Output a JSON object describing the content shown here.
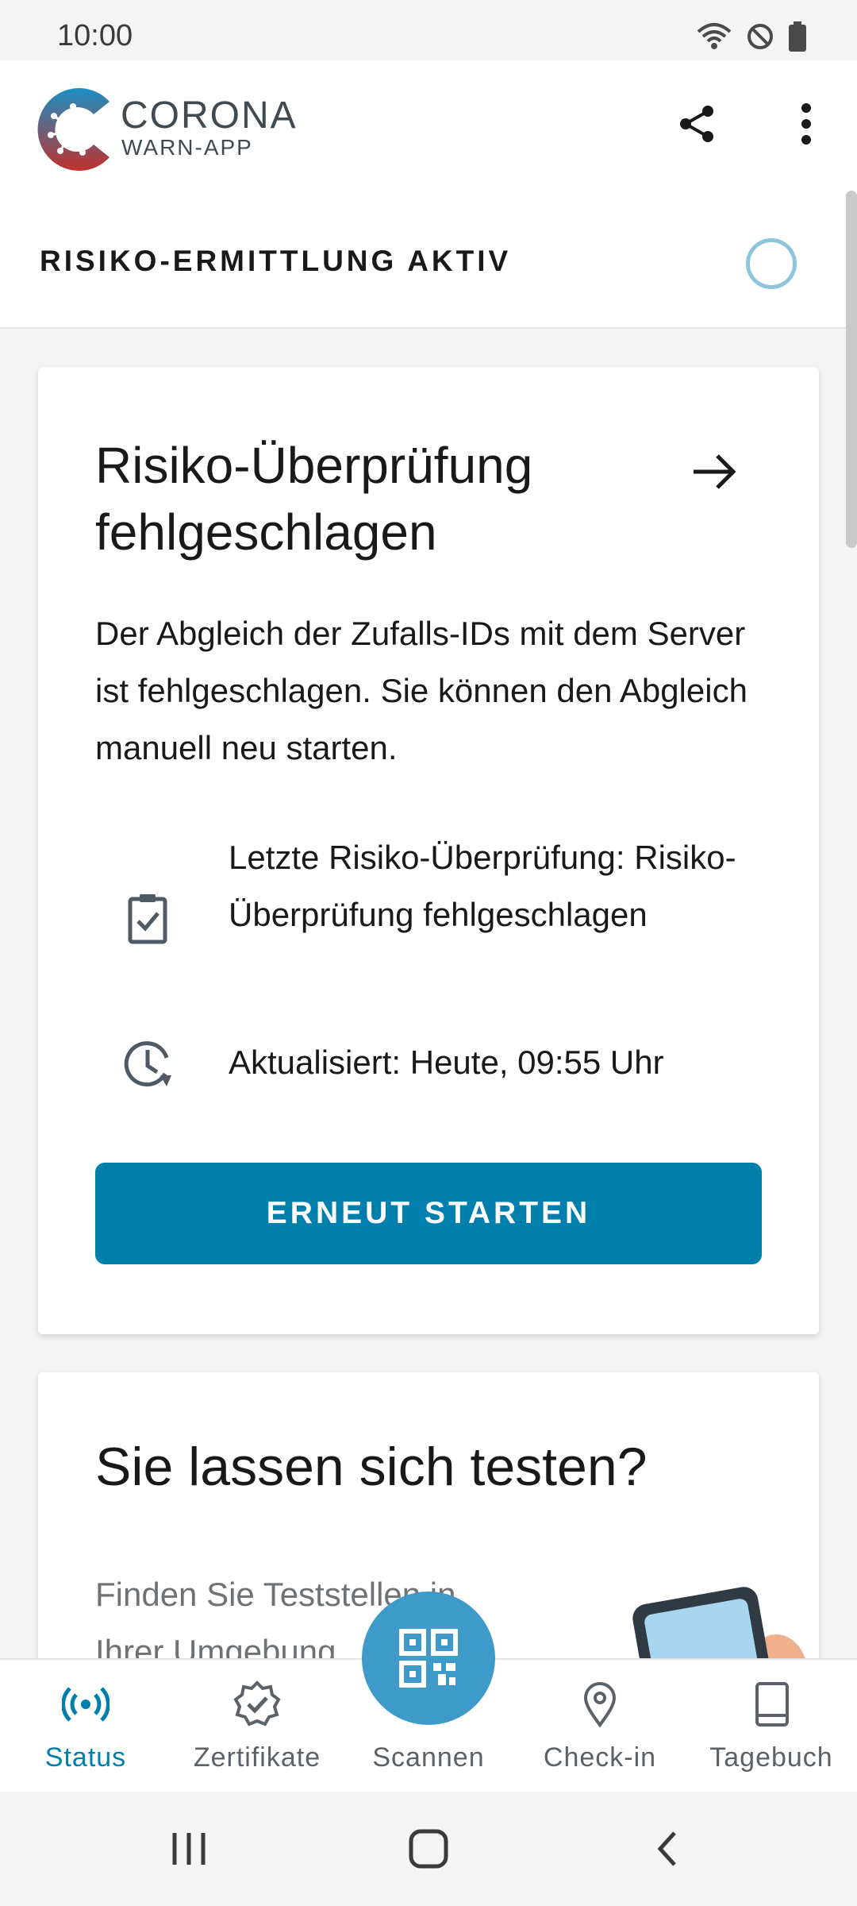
{
  "status_bar": {
    "time": "10:00",
    "icons": [
      "wifi-icon",
      "do-not-disturb-icon",
      "battery-icon"
    ]
  },
  "header": {
    "logo_title": "CORONA",
    "logo_subtitle": "WARN-APP",
    "actions": [
      "share-icon",
      "more-vert-icon"
    ]
  },
  "risk_bar": {
    "label": "RISIKO-ERMITTLUNG AKTIV"
  },
  "risk_card": {
    "title": "Risiko-Überprüfung fehlgeschlagen",
    "body": "Der Abgleich der Zufalls-IDs mit dem Server ist fehlgeschlagen. Sie können den Abgleich manuell neu starten.",
    "last_check": "Letzte Risiko-Überprüfung: Risiko-Überprüfung fehlgeschlagen",
    "updated": "Aktualisiert: Heute, 09:55 Uhr",
    "button": "ERNEUT STARTEN"
  },
  "test_card": {
    "title": "Sie lassen sich testen?",
    "text": "Finden Sie Teststellen in Ihrer Umgebung"
  },
  "bottom_nav": {
    "items": [
      {
        "label": "Status",
        "icon": "radar-icon",
        "active": true
      },
      {
        "label": "Zertifikate",
        "icon": "certificate-icon",
        "active": false
      },
      {
        "label": "Scannen",
        "icon": "qr-code-icon",
        "active": false
      },
      {
        "label": "Check-in",
        "icon": "location-pin-icon",
        "active": false
      },
      {
        "label": "Tagebuch",
        "icon": "book-icon",
        "active": false
      }
    ]
  },
  "colors": {
    "primary": "#007fad",
    "fab": "#3e9bc9",
    "ring": "#8fc5dc",
    "logo_red": "#c0302e",
    "logo_blue": "#1b8fc4"
  }
}
